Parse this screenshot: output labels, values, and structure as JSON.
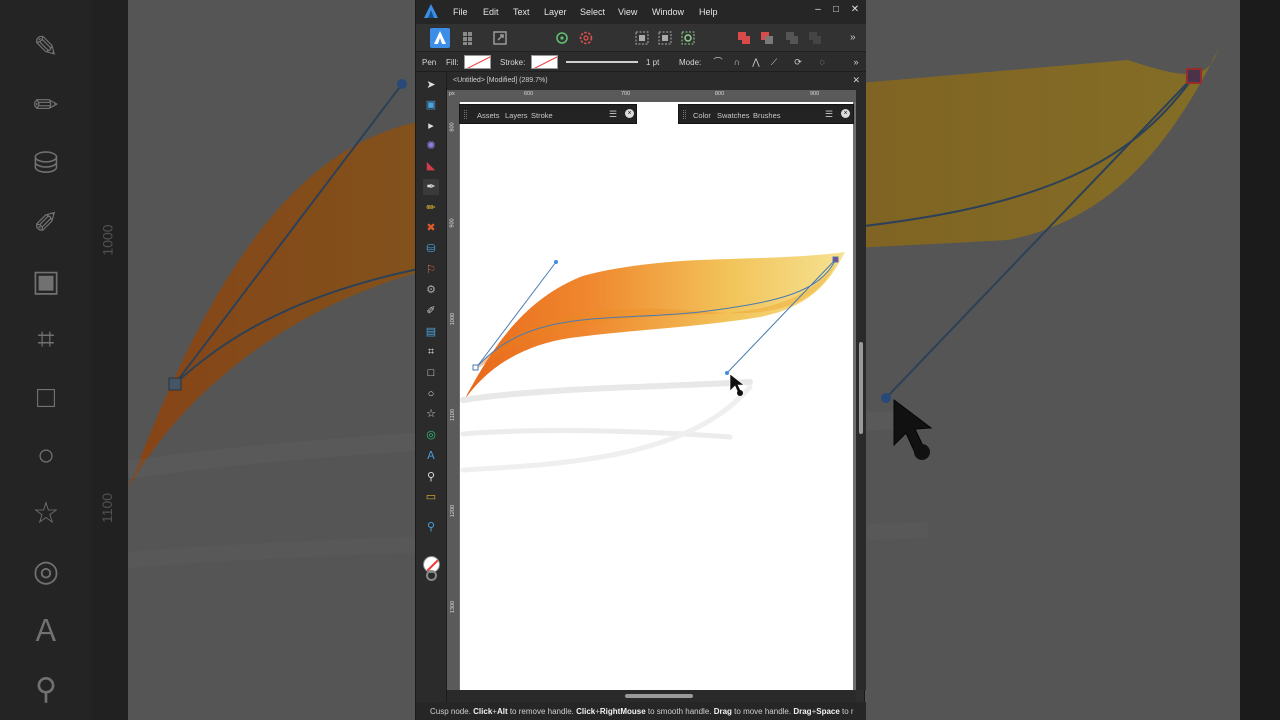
{
  "menu": {
    "items": [
      "File",
      "Edit",
      "Text",
      "Layer",
      "Select",
      "View",
      "Window",
      "Help"
    ]
  },
  "window_controls": {
    "minimize": "–",
    "maximize": "□",
    "close": "✕"
  },
  "context_toolbar": {
    "tool_name": "Pen",
    "fill_label": "Fill:",
    "stroke_label": "Stroke:",
    "stroke_width": "1 pt",
    "mode_label": "Mode:"
  },
  "document": {
    "tab_title": "<Untitled> [Modified] (289.7%)",
    "close_glyph": "✕"
  },
  "rulers": {
    "horizontal": [
      "px",
      "600",
      "700",
      "800",
      "900"
    ],
    "vertical": [
      "800",
      "900",
      "1000",
      "1100",
      "1200",
      "1300"
    ]
  },
  "panels": {
    "left": {
      "tabs": [
        "Assets",
        "Layers",
        "Stroke"
      ]
    },
    "right": {
      "tabs": [
        "Color",
        "Swatches",
        "Brushes"
      ]
    },
    "menu_glyph": "☰",
    "close_glyph": "×"
  },
  "statusbar": {
    "t1": "Cusp node. ",
    "b1": "Click",
    "sep1": "+",
    "b2": "Alt",
    "t2": " to remove handle. ",
    "b3": "Click",
    "sep2": "+",
    "b4": "RightMouse",
    "t3": " to smooth handle. ",
    "b5": "Drag",
    "t4": " to move handle. ",
    "b6": "Drag",
    "sep3": "+",
    "b7": "Space",
    "t5": " to r"
  },
  "background_rulers": [
    "1000",
    "1100"
  ],
  "colors": {
    "accent_blue": "#3d8ee6",
    "shape_orange": "#e8761c",
    "shape_yellow": "#f2c84a",
    "path_line": "#4a7ab0"
  },
  "icons": {
    "app": "affinity-designer-logo-icon"
  }
}
